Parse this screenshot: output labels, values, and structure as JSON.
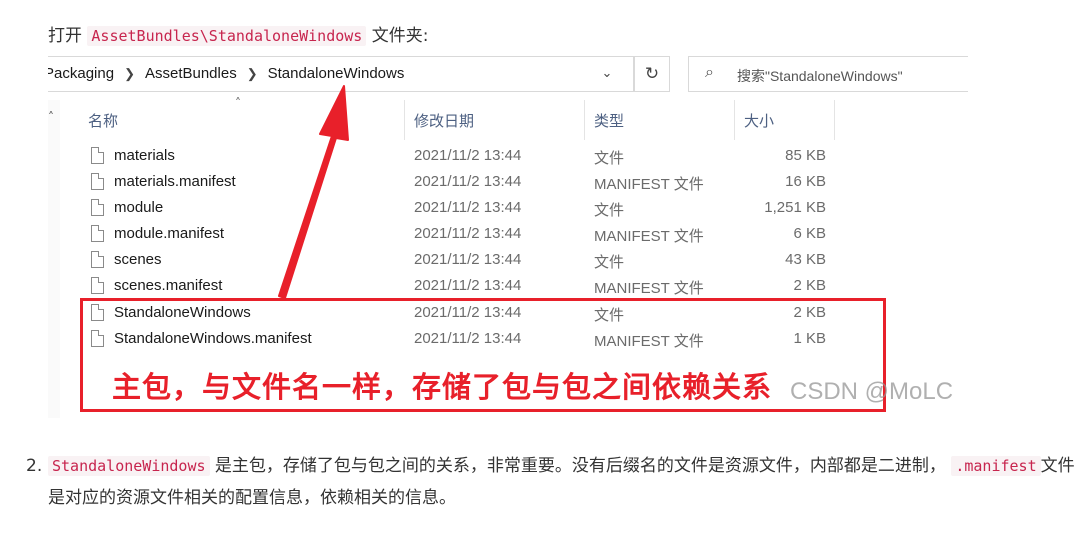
{
  "intro": {
    "prefix": "打开",
    "path_code": "AssetBundles\\StandaloneWindows",
    "suffix": "文件夹:"
  },
  "explorer": {
    "breadcrumb": [
      "Packaging",
      "AssetBundles",
      "StandaloneWindows"
    ],
    "search_placeholder": "搜索\"StandaloneWindows\"",
    "columns": [
      "名称",
      "修改日期",
      "类型",
      "大小"
    ],
    "files": [
      {
        "name": "materials",
        "date": "2021/11/2 13:44",
        "type": "文件",
        "size": "85 KB"
      },
      {
        "name": "materials.manifest",
        "date": "2021/11/2 13:44",
        "type": "MANIFEST 文件",
        "size": "16 KB"
      },
      {
        "name": "module",
        "date": "2021/11/2 13:44",
        "type": "文件",
        "size": "1,251 KB"
      },
      {
        "name": "module.manifest",
        "date": "2021/11/2 13:44",
        "type": "MANIFEST 文件",
        "size": "6 KB"
      },
      {
        "name": "scenes",
        "date": "2021/11/2 13:44",
        "type": "文件",
        "size": "43 KB"
      },
      {
        "name": "scenes.manifest",
        "date": "2021/11/2 13:44",
        "type": "MANIFEST 文件",
        "size": "2 KB"
      },
      {
        "name": "StandaloneWindows",
        "date": "2021/11/2 13:44",
        "type": "文件",
        "size": "2 KB"
      },
      {
        "name": "StandaloneWindows.manifest",
        "date": "2021/11/2 13:44",
        "type": "MANIFEST 文件",
        "size": "1 KB"
      }
    ],
    "annotation": "主包，与文件名一样，存储了包与包之间依赖关系",
    "watermark": "CSDN @MoLC",
    "accent_color": "#e8202a"
  },
  "item2": {
    "number": "2.",
    "code1": "StandaloneWindows",
    "text1": " 是主包，存储了包与包之间的关系，非常重要。没有后缀名的文件是资源文件，内部都是二进制，",
    "code2": ".manifest",
    "text2": "文件是对应的资源文件相关的配置信息，依赖相关的信息。"
  }
}
